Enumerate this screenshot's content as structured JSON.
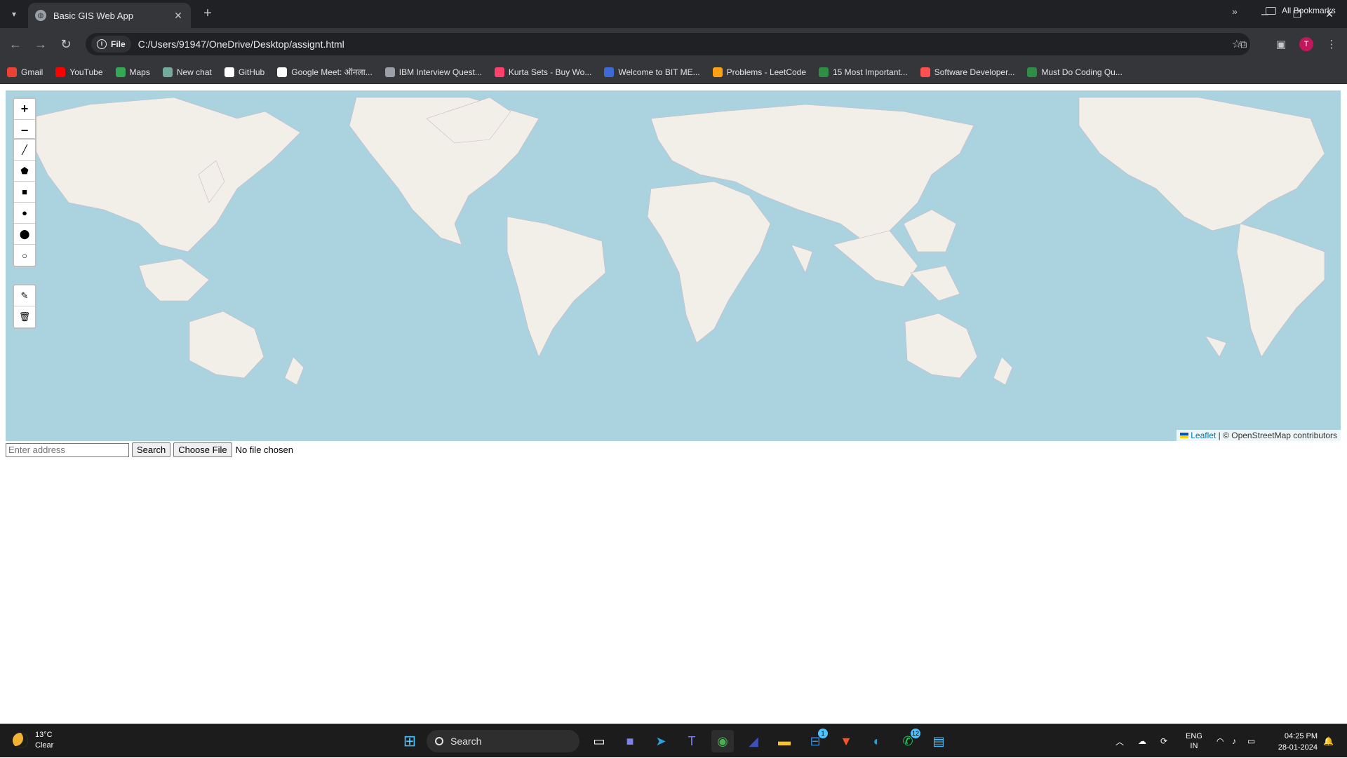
{
  "browser": {
    "tab_title": "Basic GIS Web App",
    "url_chip": "File",
    "url": "C:/Users/91947/OneDrive/Desktop/assignt.html",
    "avatar_letter": "T",
    "bookmarks": [
      {
        "label": "Gmail",
        "icon": "gmail-icon",
        "color": "#ea4335"
      },
      {
        "label": "YouTube",
        "icon": "youtube-icon",
        "color": "#ff0000"
      },
      {
        "label": "Maps",
        "icon": "maps-icon",
        "color": "#34a853"
      },
      {
        "label": "New chat",
        "icon": "chatgpt-icon",
        "color": "#74aa9c"
      },
      {
        "label": "GitHub",
        "icon": "github-icon",
        "color": "#ffffff"
      },
      {
        "label": "Google Meet: ऑनला...",
        "icon": "google-icon",
        "color": "#ffffff"
      },
      {
        "label": "IBM Interview Quest...",
        "icon": "globe-icon",
        "color": "#9aa0a6"
      },
      {
        "label": "Kurta Sets - Buy Wo...",
        "icon": "myntra-icon",
        "color": "#ff3f6c"
      },
      {
        "label": "Welcome to BIT ME...",
        "icon": "bit-icon",
        "color": "#3d6ad6"
      },
      {
        "label": "Problems - LeetCode",
        "icon": "leetcode-icon",
        "color": "#ffa116"
      },
      {
        "label": "15 Most Important...",
        "icon": "gfg-icon",
        "color": "#2f8d46"
      },
      {
        "label": "Software Developer...",
        "icon": "naukri-icon",
        "color": "#ff4f4f"
      },
      {
        "label": "Must Do Coding Qu...",
        "icon": "gfg-icon",
        "color": "#2f8d46"
      }
    ],
    "all_bookmarks": "All Bookmarks"
  },
  "map": {
    "zoom_in": "+",
    "zoom_out": "−",
    "draw_tools": [
      "polyline",
      "polygon",
      "rectangle",
      "circle",
      "marker",
      "circlemarker"
    ],
    "edit_tools": [
      "edit",
      "delete"
    ],
    "attribution_leaflet": "Leaflet",
    "attribution_osm": "| © OpenStreetMap contributors",
    "colors": {
      "water": "#aad3df",
      "land": "#f2efe9"
    }
  },
  "controls": {
    "address_placeholder": "Enter address",
    "search_label": "Search",
    "file_label": "Choose File",
    "file_status": "No file chosen"
  },
  "taskbar": {
    "temperature": "13°C",
    "condition": "Clear",
    "search_label": "Search",
    "lang_top": "ENG",
    "lang_bottom": "IN",
    "time": "04:25 PM",
    "date": "28-01-2024",
    "store_badge": "1",
    "whatsapp_badge": "12"
  }
}
